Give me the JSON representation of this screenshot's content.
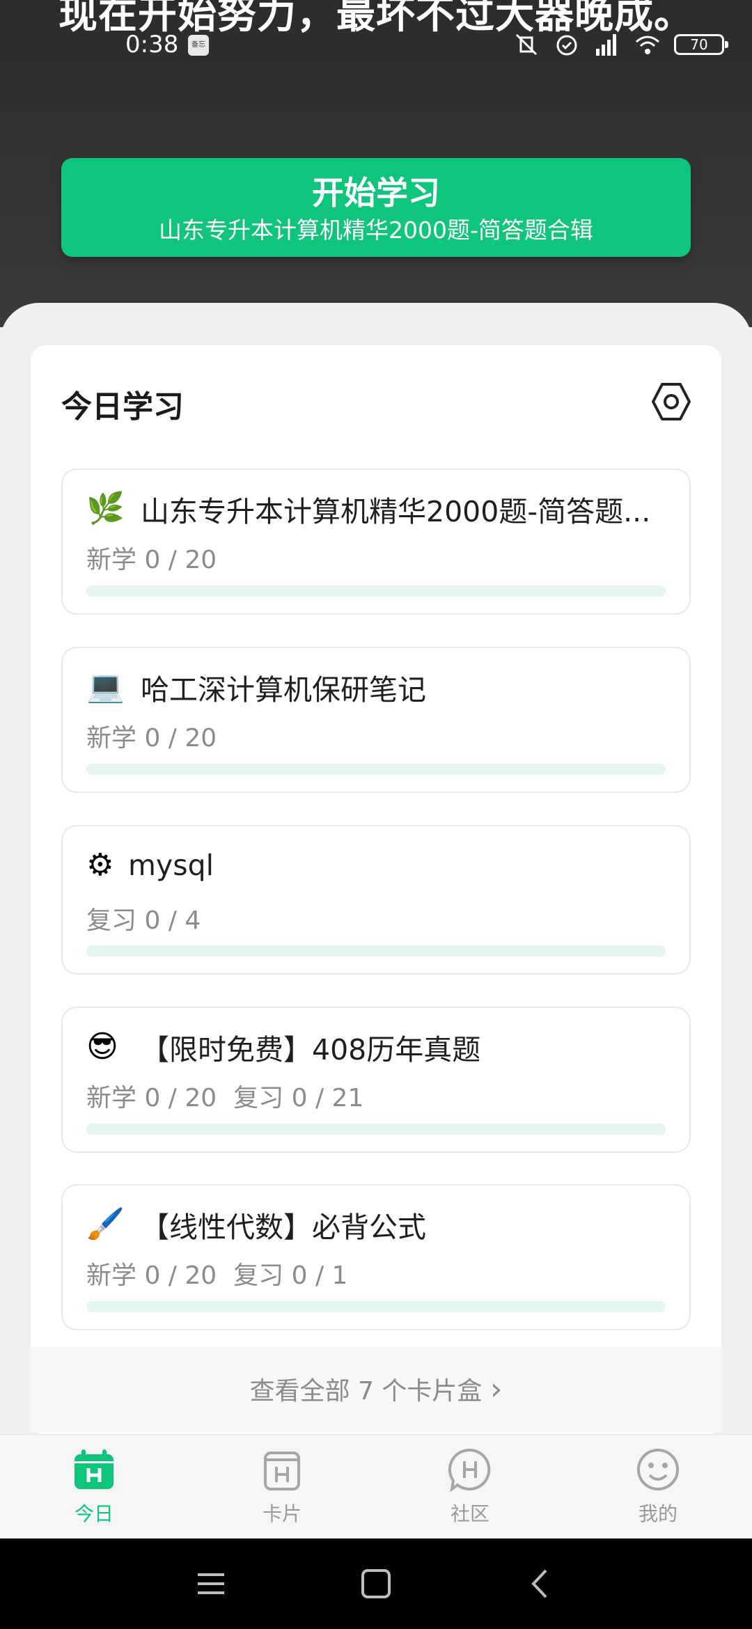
{
  "status_bar": {
    "time": "0:38",
    "note_icon_text": "备忘",
    "battery": "70",
    "icons": [
      "mute-vibrate-icon",
      "alarm-icon",
      "signal-icon",
      "wifi-icon",
      "battery-icon"
    ]
  },
  "header": {
    "motto": "现在开始努力，最坏不过大器晚成。",
    "start_button": {
      "title": "开始学习",
      "subtitle": "山东专升本计算机精华2000题-简答题合辑"
    }
  },
  "today": {
    "title": "今日学习",
    "settings_icon": "settings-hexagon-icon",
    "decks": [
      {
        "emoji": "🌿",
        "name": "山东专升本计算机精华2000题-简答题...",
        "stats": [
          "新学 0 / 20"
        ],
        "progress": 0
      },
      {
        "emoji": "💻",
        "name": "哈工深计算机保研笔记",
        "stats": [
          "新学 0 / 20"
        ],
        "progress": 0
      },
      {
        "emoji": "⚙",
        "name": "mysql",
        "stats": [
          "复习 0 / 4"
        ],
        "progress": 0
      },
      {
        "emoji": "😎",
        "name": "【限时免费】408历年真题",
        "stats": [
          "新学 0 / 20",
          "复习 0 / 21"
        ],
        "progress": 0
      },
      {
        "emoji": "🖌️",
        "name": "【线性代数】必背公式",
        "stats": [
          "新学 0 / 20",
          "复习 0 / 1"
        ],
        "progress": 0
      }
    ],
    "view_all": "查看全部 7 个卡片盒",
    "view_all_arrow": "›"
  },
  "tabbar": {
    "tabs": [
      {
        "label": "今日",
        "icon": "calendar-icon",
        "active": true
      },
      {
        "label": "卡片",
        "icon": "card-box-icon",
        "active": false
      },
      {
        "label": "社区",
        "icon": "community-chat-icon",
        "active": false
      },
      {
        "label": "我的",
        "icon": "smiley-profile-icon",
        "active": false
      }
    ]
  },
  "colors": {
    "accent": "#0fc47b",
    "header_bg": "#333333",
    "muted_text": "#8b8b8b"
  }
}
